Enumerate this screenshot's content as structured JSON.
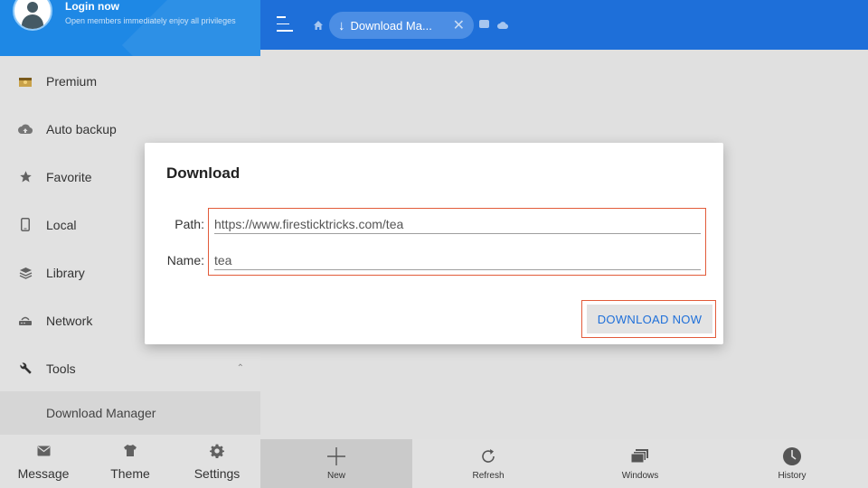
{
  "sidebar": {
    "login_title": "Login now",
    "login_subtitle": "Open members immediately enjoy all privileges",
    "items": [
      {
        "label": "Premium",
        "icon": "crown-icon"
      },
      {
        "label": "Auto backup",
        "icon": "cloud-upload-icon"
      },
      {
        "label": "Favorite",
        "icon": "star-icon"
      },
      {
        "label": "Local",
        "icon": "phone-icon"
      },
      {
        "label": "Library",
        "icon": "layers-icon"
      },
      {
        "label": "Network",
        "icon": "router-icon"
      },
      {
        "label": "Tools",
        "icon": "wrench-icon"
      }
    ],
    "sub_item": "Download Manager",
    "bottom": [
      {
        "label": "Message",
        "icon": "envelope-icon"
      },
      {
        "label": "Theme",
        "icon": "shirt-icon"
      },
      {
        "label": "Settings",
        "icon": "gear-icon"
      }
    ]
  },
  "topbar": {
    "tab_label": "Download Ma...",
    "tab_close": "✕",
    "tab_arrow": "↓"
  },
  "bottom_nav": [
    {
      "label": "New",
      "icon": "plus-icon",
      "active": true
    },
    {
      "label": "Refresh",
      "icon": "refresh-icon"
    },
    {
      "label": "Windows",
      "icon": "windows-icon"
    },
    {
      "label": "History",
      "icon": "clock-icon"
    }
  ],
  "dialog": {
    "title": "Download",
    "path_label": "Path:",
    "path_value": "https://www.firesticktricks.com/tea",
    "name_label": "Name:",
    "name_value": "tea",
    "button_label": "DOWNLOAD NOW"
  },
  "colors": {
    "accent": "#1e6fd9",
    "highlight": "#e25b3a"
  }
}
